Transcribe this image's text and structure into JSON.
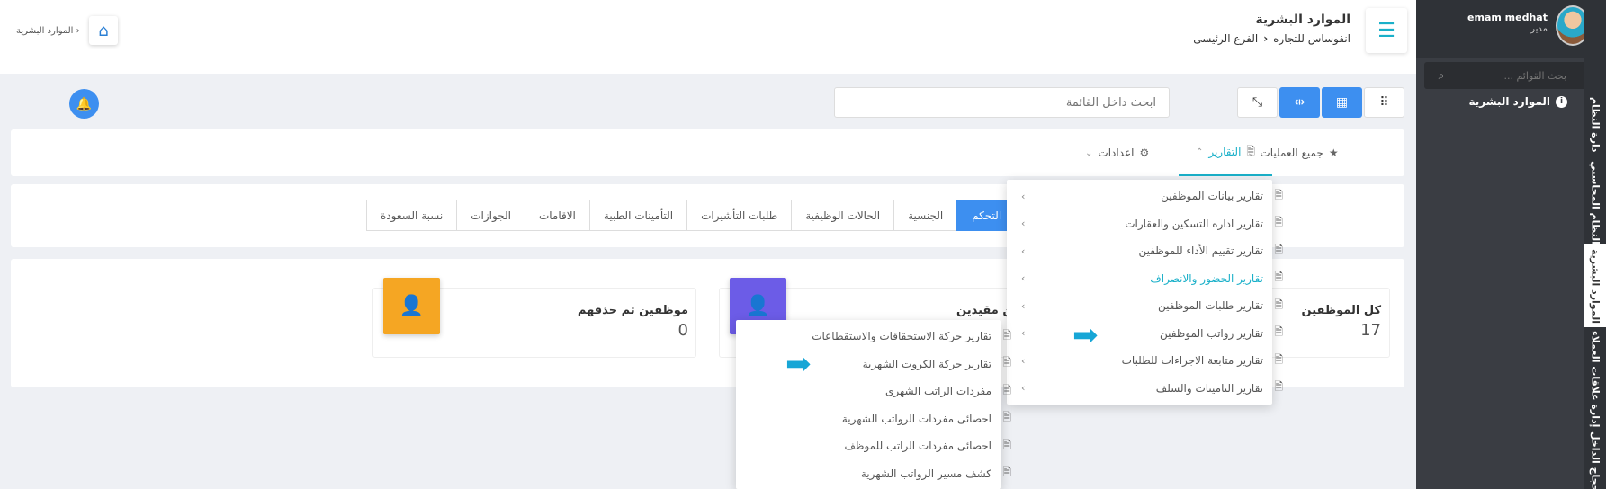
{
  "sidebar": {
    "user_name": "emam medhat",
    "user_role": "مدير",
    "search_placeholder": "بحث القوائم ...",
    "active_item": "الموارد البشرية",
    "vertical_tabs": [
      "دارة النظام",
      "النظام المحاسبي",
      "الموارد البشرية",
      "إدارة علاقات العملاء",
      "حجاج الداخل"
    ]
  },
  "header": {
    "title": "الموارد البشرية",
    "company": "انفوساس للتجاره",
    "branch": "الفرع الرئيسى",
    "home_crumb": "الموارد البشرية"
  },
  "toolbar": {
    "search_placeholder": "ابحث داخل القائمة"
  },
  "tabs": {
    "all_ops": "جميع العمليات",
    "reports": "التقارير",
    "settings": "اعدادات"
  },
  "categories": [
    "التحكم",
    "الجنسية",
    "الحالات الوظيفية",
    "طلبات التأشيرات",
    "التأمينات الطبية",
    "الاقامات",
    "الجوازات",
    "نسبة السعودة"
  ],
  "cards": {
    "all_employees": {
      "title": "كل الموظفين",
      "value": "17"
    },
    "restricted": {
      "title": "ين مقيدين"
    },
    "deleted": {
      "title": "موظفين تم حذفهم",
      "value": "0"
    }
  },
  "reports_menu": [
    "تقارير بيانات الموظفين",
    "تقارير اداره التسكين والعقارات",
    "تقارير تقييم الأداء للموظفين",
    "تقارير الحضور والانصراف",
    "تقارير طلبات الموظفين",
    "تقارير رواتب الموظفين",
    "تقارير متابعة الاجراءات للطلبات",
    "تقارير التامينات والسلف"
  ],
  "salary_submenu": [
    "تقارير حركة الاستحقاقات والاستقطاعات",
    "تقارير حركة الكروت الشهرية",
    "مفردات الراتب الشهرى",
    "احصائى مفردات الرواتب الشهرية",
    "احصائى مفردات الراتب للموظف",
    "كشف مسير الرواتب الشهرية"
  ],
  "colors": {
    "accent": "#1ab0c9",
    "primary": "#3d8ff0",
    "orange": "#f5a623",
    "purple": "#6c5ce7",
    "sidebar": "#3a3d43"
  }
}
